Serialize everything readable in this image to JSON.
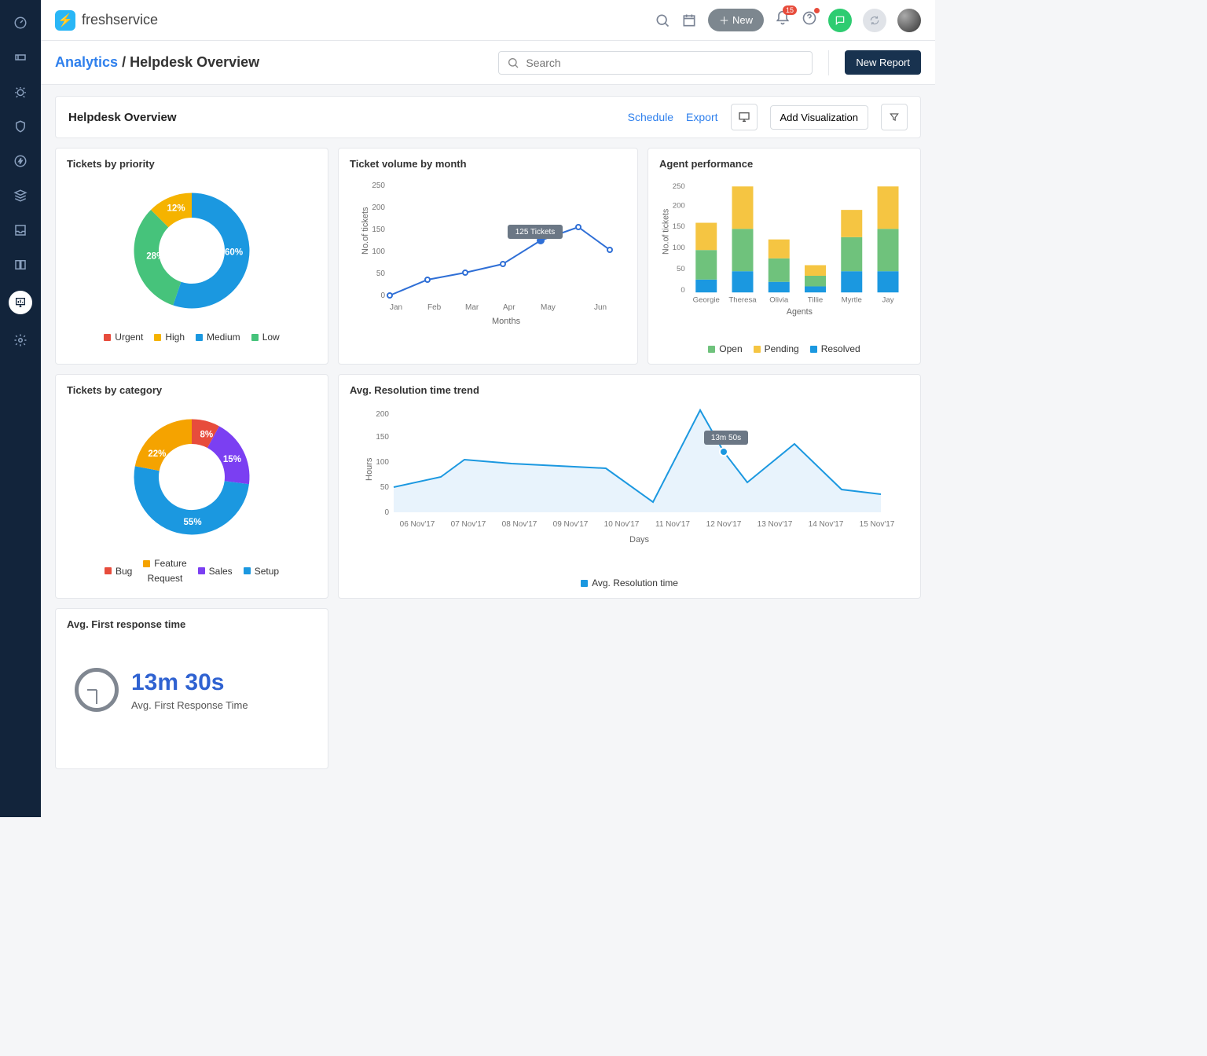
{
  "brand": "freshservice",
  "topbar": {
    "new_label": "New",
    "notif_count": "15"
  },
  "subbar": {
    "crumb_root": "Analytics",
    "crumb_sep": "/",
    "crumb_page": "Helpdesk Overview",
    "search_placeholder": "Search",
    "new_report": "New Report"
  },
  "page": {
    "title": "Helpdesk Overview",
    "schedule": "Schedule",
    "export": "Export",
    "add_viz": "Add Visualization"
  },
  "priority": {
    "title": "Tickets by priority",
    "legend": [
      "Urgent",
      "High",
      "Medium",
      "Low"
    ],
    "colors": {
      "Urgent": "#e74c3c",
      "High": "#f5b300",
      "Medium": "#1b98e0",
      "Low": "#46c37b"
    },
    "labels": {
      "High": "12%",
      "Medium": "60%",
      "Low": "28%"
    }
  },
  "category": {
    "title": "Tickets by category",
    "legend": [
      "Bug",
      "Feature Request",
      "Sales",
      "Setup"
    ],
    "colors": {
      "Bug": "#e74c3c",
      "Feature Request": "#f5a300",
      "Sales": "#7b3ff2",
      "Setup": "#1b98e0"
    },
    "labels": {
      "Bug": "8%",
      "Feature Request": "22%",
      "Sales": "15%",
      "Setup": "55%"
    }
  },
  "volume": {
    "title": "Ticket volume by month",
    "xlabel": "Months",
    "ylabel": "No.of tickets",
    "tooltip": "125 Tickets"
  },
  "agent": {
    "title": "Agent performance",
    "xlabel": "Agents",
    "ylabel": "No.of tickets",
    "legend": [
      "Open",
      "Pending",
      "Resolved"
    ],
    "colors": {
      "Open": "#6fc27c",
      "Pending": "#f5c542",
      "Resolved": "#1b98e0"
    }
  },
  "resolution": {
    "title": "Avg. Resolution time trend",
    "ylabel": "Hours",
    "xlabel": "Days",
    "tooltip": "13m 50s",
    "legend": "Avg. Resolution time"
  },
  "kpi": {
    "title": "Avg. First response time",
    "value": "13m 30s",
    "caption": "Avg. First Response Time"
  },
  "chart_data": [
    {
      "id": "tickets_by_priority",
      "type": "pie",
      "title": "Tickets by priority",
      "series": [
        {
          "name": "Urgent",
          "value_pct": 0
        },
        {
          "name": "High",
          "value_pct": 12
        },
        {
          "name": "Medium",
          "value_pct": 60
        },
        {
          "name": "Low",
          "value_pct": 28
        }
      ]
    },
    {
      "id": "tickets_by_category",
      "type": "pie",
      "title": "Tickets by category",
      "series": [
        {
          "name": "Bug",
          "value_pct": 8
        },
        {
          "name": "Feature Request",
          "value_pct": 22
        },
        {
          "name": "Sales",
          "value_pct": 15
        },
        {
          "name": "Setup",
          "value_pct": 55
        }
      ]
    },
    {
      "id": "ticket_volume_by_month",
      "type": "line",
      "title": "Ticket volume by month",
      "xlabel": "Months",
      "ylabel": "No.of tickets",
      "ylim": [
        0,
        250
      ],
      "x": [
        "Jan",
        "Feb",
        "Mar",
        "Apr",
        "May",
        "Jun"
      ],
      "values": [
        0,
        35,
        52,
        72,
        125,
        155,
        104
      ],
      "highlight": {
        "x": "Apr",
        "value": 125,
        "label": "125 Tickets"
      }
    },
    {
      "id": "agent_performance",
      "type": "bar",
      "stacked": true,
      "title": "Agent performance",
      "xlabel": "Agents",
      "ylabel": "No.of tickets",
      "ylim": [
        0,
        250
      ],
      "categories": [
        "Georgie",
        "Theresa",
        "Olivia",
        "Tillie",
        "Myrtle",
        "Jay"
      ],
      "series": [
        {
          "name": "Resolved",
          "values": [
            30,
            50,
            25,
            15,
            50,
            50
          ]
        },
        {
          "name": "Open",
          "values": [
            70,
            100,
            55,
            25,
            80,
            100
          ]
        },
        {
          "name": "Pending",
          "values": [
            65,
            100,
            45,
            25,
            65,
            100
          ]
        }
      ]
    },
    {
      "id": "avg_resolution_time_trend",
      "type": "area",
      "title": "Avg. Resolution time trend",
      "xlabel": "Days",
      "ylabel": "Hours",
      "ylim": [
        0,
        200
      ],
      "x": [
        "06 Nov'17",
        "07 Nov'17",
        "08 Nov'17",
        "09 Nov'17",
        "10 Nov'17",
        "11 Nov'17",
        "12 Nov'17",
        "13 Nov'17",
        "14 Nov'17",
        "15 Nov'17"
      ],
      "values": [
        50,
        70,
        112,
        100,
        95,
        20,
        200,
        60,
        135,
        45,
        35
      ],
      "highlight": {
        "x": "12 Nov'17",
        "value": 118,
        "label": "13m 50s"
      }
    }
  ]
}
